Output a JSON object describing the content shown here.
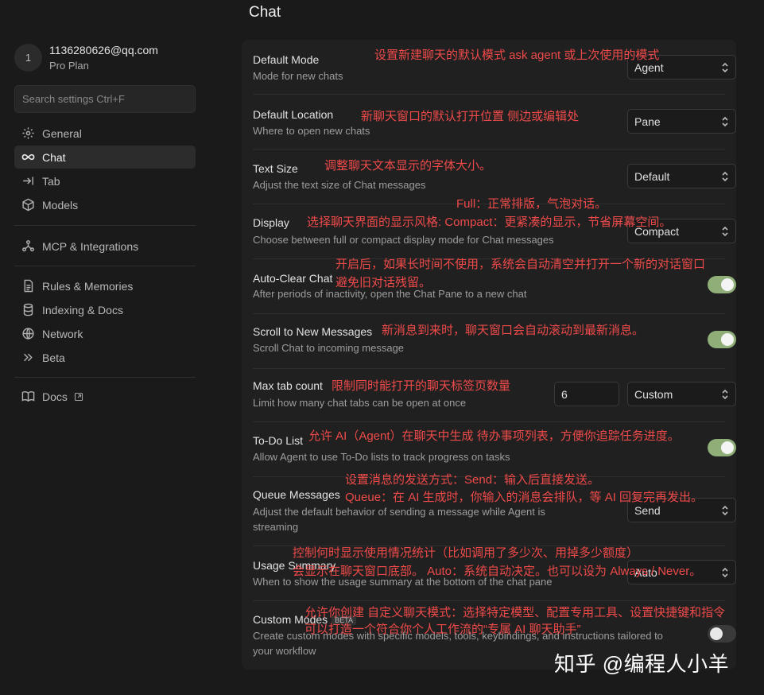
{
  "user": {
    "avatar_initial": "1",
    "email": "1136280626@qq.com",
    "plan": "Pro Plan"
  },
  "search": {
    "placeholder": "Search settings Ctrl+F"
  },
  "nav": {
    "group1": [
      {
        "label": "General",
        "icon": "gear-icon"
      },
      {
        "label": "Chat",
        "icon": "infinity-icon"
      },
      {
        "label": "Tab",
        "icon": "tab-arrow-icon"
      },
      {
        "label": "Models",
        "icon": "cube-icon"
      }
    ],
    "group2": [
      {
        "label": "MCP & Integrations",
        "icon": "nodes-icon"
      }
    ],
    "group3": [
      {
        "label": "Rules & Memories",
        "icon": "document-icon"
      },
      {
        "label": "Indexing & Docs",
        "icon": "database-icon"
      },
      {
        "label": "Network",
        "icon": "globe-icon"
      },
      {
        "label": "Beta",
        "icon": "double-chevron-icon"
      }
    ],
    "group4": [
      {
        "label": "Docs",
        "icon": "book-icon"
      }
    ]
  },
  "page": {
    "title": "Chat"
  },
  "settings": [
    {
      "title": "Default Mode",
      "desc": "Mode for new chats",
      "control": "select",
      "value": "Agent",
      "note": "设置新建聊天的默认模式 ask agent 或上次使用的模式"
    },
    {
      "title": "Default Location",
      "desc": "Where to open new chats",
      "control": "select",
      "value": "Pane",
      "note": "新聊天窗口的默认打开位置 侧边或编辑处"
    },
    {
      "title": "Text Size",
      "desc": "Adjust the text size of Chat messages",
      "control": "select",
      "value": "Default",
      "note": "调整聊天文本显示的字体大小。"
    },
    {
      "title": "Display",
      "desc": "Choose between full or compact display mode for Chat messages",
      "control": "select",
      "value": "Compact",
      "note": "Full：正常排版，气泡对话。",
      "note2": "选择聊天界面的显示风格: Compact：更紧凑的显示，节省屏幕空间。"
    },
    {
      "title": "Auto-Clear Chat",
      "desc": "After periods of inactivity, open the Chat Pane to a new chat",
      "control": "toggle",
      "enabled": true,
      "note": "开启后，如果长时间不使用，系统会自动清空并打开一个新的对话窗口",
      "note2": "避免旧对话残留。"
    },
    {
      "title": "Scroll to New Messages",
      "desc": "Scroll Chat to incoming message",
      "control": "toggle",
      "enabled": true,
      "note": "新消息到来时，聊天窗口会自动滚动到最新消息。"
    },
    {
      "title": "Max tab count",
      "desc": "Limit how many chat tabs can be open at once",
      "control": "number+select",
      "number": "6",
      "value": "Custom",
      "note": "限制同时能打开的聊天标签页数量"
    },
    {
      "title": "To-Do List",
      "desc": "Allow Agent to use To-Do lists to track progress on tasks",
      "control": "toggle",
      "enabled": true,
      "note": "允许 AI（Agent）在聊天中生成 待办事项列表，方便你追踪任务进度。"
    },
    {
      "title": "Queue Messages",
      "desc": "Adjust the default behavior of sending a message while Agent is streaming",
      "control": "select",
      "value": "Send",
      "note": "设置消息的发送方式：Send：输入后直接发送。",
      "note2": "Queue：在 AI 生成时，你输入的消息会排队，等 AI 回复完再发出。"
    },
    {
      "title": "Usage Summary",
      "desc": "When to show the usage summary at the bottom of the chat pane",
      "control": "select",
      "value": "Auto",
      "note": "控制何时显示使用情况统计（比如调用了多少次、用掉多少额度）",
      "note2": "会显示在聊天窗口底部。 Auto：系统自动决定。也可以设为 Always / Never。"
    },
    {
      "title": "Custom Modes",
      "badge": "BETA",
      "desc": "Create custom modes with specific models, tools, keybindings, and instructions tailored to your workflow",
      "control": "toggle",
      "enabled": false,
      "note": "允许你创建 自定义聊天模式：选择特定模型、配置专用工具、设置快捷键和指令",
      "note2": "可以打造一个符合你个人工作流的“专属 AI 聊天助手”"
    }
  ],
  "watermark": "知乎 @编程人小羊",
  "colors": {
    "accent_toggle": "#8fae78",
    "annotation": "#ef4a4a",
    "panel": "#202020",
    "background": "#1a1a1a"
  }
}
